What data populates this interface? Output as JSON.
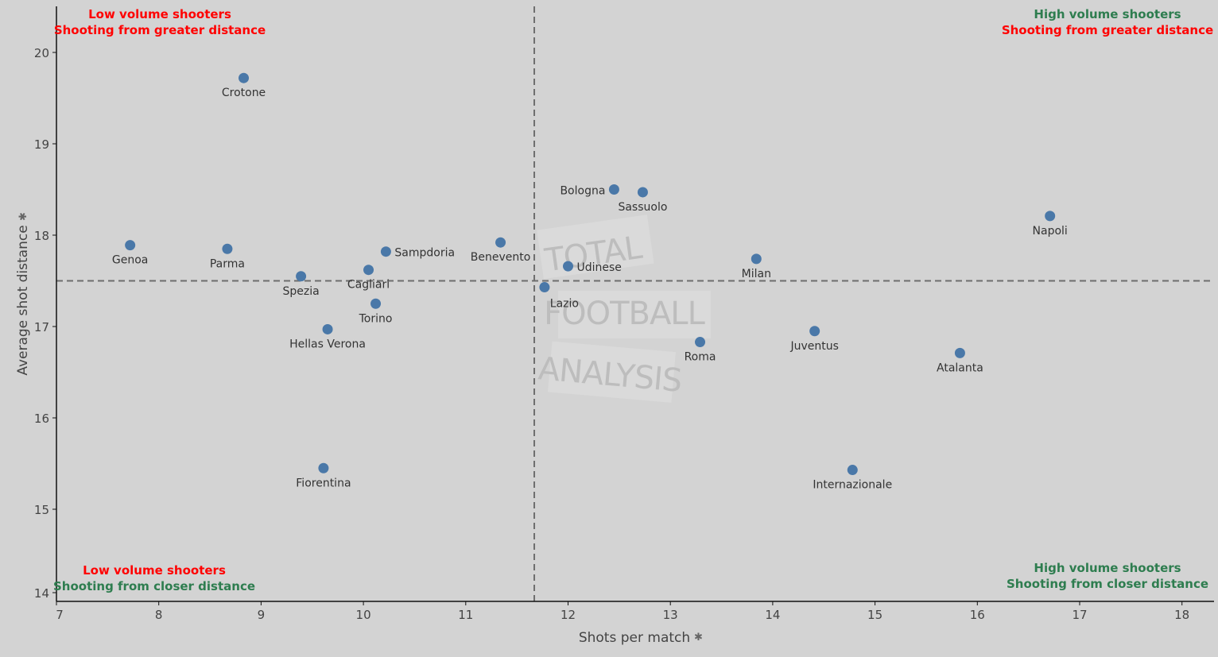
{
  "chart_data": {
    "type": "scatter",
    "title": "",
    "xlabel": "Shots per match",
    "ylabel": "Average shot distance",
    "xlim": [
      7,
      18.3
    ],
    "ylim": [
      14,
      20.5
    ],
    "xticks": [
      7,
      8,
      9,
      10,
      11,
      12,
      13,
      14,
      15,
      16,
      17,
      18
    ],
    "yticks": [
      14,
      15,
      16,
      17,
      18,
      19,
      20
    ],
    "grid": false,
    "point_color": "#4a78a8",
    "reference_lines": {
      "x_mean": 11.67,
      "y_mean": 17.5,
      "style": "dashed",
      "color": "#6e6e6e"
    },
    "points": [
      {
        "label": "Crotone",
        "x": 8.83,
        "y": 19.72,
        "label_pos": "below"
      },
      {
        "label": "Genoa",
        "x": 7.72,
        "y": 17.89,
        "label_pos": "below"
      },
      {
        "label": "Parma",
        "x": 8.67,
        "y": 17.85,
        "label_pos": "below"
      },
      {
        "label": "Spezia",
        "x": 9.39,
        "y": 17.55,
        "label_pos": "below"
      },
      {
        "label": "Cagliari",
        "x": 10.05,
        "y": 17.62,
        "label_pos": "below"
      },
      {
        "label": "Sampdoria",
        "x": 10.22,
        "y": 17.82,
        "label_pos": "right"
      },
      {
        "label": "Torino",
        "x": 10.12,
        "y": 17.25,
        "label_pos": "below"
      },
      {
        "label": "Hellas Verona",
        "x": 9.65,
        "y": 16.97,
        "label_pos": "below"
      },
      {
        "label": "Fiorentina",
        "x": 9.61,
        "y": 15.45,
        "label_pos": "below"
      },
      {
        "label": "Benevento",
        "x": 11.34,
        "y": 17.92,
        "label_pos": "below"
      },
      {
        "label": "Bologna",
        "x": 12.45,
        "y": 18.5,
        "label_pos": "left"
      },
      {
        "label": "Sassuolo",
        "x": 12.73,
        "y": 18.47,
        "label_pos": "below"
      },
      {
        "label": "Udinese",
        "x": 12.0,
        "y": 17.66,
        "label_pos": "right"
      },
      {
        "label": "Lazio",
        "x": 11.77,
        "y": 17.43,
        "label_pos": "below-right"
      },
      {
        "label": "Milan",
        "x": 13.84,
        "y": 17.74,
        "label_pos": "below"
      },
      {
        "label": "Roma",
        "x": 13.29,
        "y": 16.83,
        "label_pos": "below"
      },
      {
        "label": "Juventus",
        "x": 14.41,
        "y": 16.95,
        "label_pos": "below"
      },
      {
        "label": "Atalanta",
        "x": 15.83,
        "y": 16.71,
        "label_pos": "below"
      },
      {
        "label": "Napoli",
        "x": 16.71,
        "y": 18.21,
        "label_pos": "below"
      },
      {
        "label": "Internazionale",
        "x": 14.78,
        "y": 15.43,
        "label_pos": "below"
      }
    ],
    "annotations": [
      {
        "quadrant": "top-left",
        "lines": [
          {
            "text": "Low volume shooters",
            "color": "#ff0000"
          },
          {
            "text": "Shooting from greater distance",
            "color": "#ff0000"
          }
        ]
      },
      {
        "quadrant": "top-right",
        "lines": [
          {
            "text": "High volume shooters",
            "color": "#2e7d4f"
          },
          {
            "text": "Shooting from greater distance",
            "color": "#ff0000"
          }
        ]
      },
      {
        "quadrant": "bottom-left",
        "lines": [
          {
            "text": "Low volume shooters",
            "color": "#ff0000"
          },
          {
            "text": "Shooting from closer distance",
            "color": "#2e7d4f"
          }
        ]
      },
      {
        "quadrant": "bottom-right",
        "lines": [
          {
            "text": "High volume shooters",
            "color": "#2e7d4f"
          },
          {
            "text": "Shooting from closer distance",
            "color": "#2e7d4f"
          }
        ]
      }
    ],
    "watermark": [
      "TOTAL",
      "FOOTBALL",
      "ANALYSIS"
    ]
  }
}
